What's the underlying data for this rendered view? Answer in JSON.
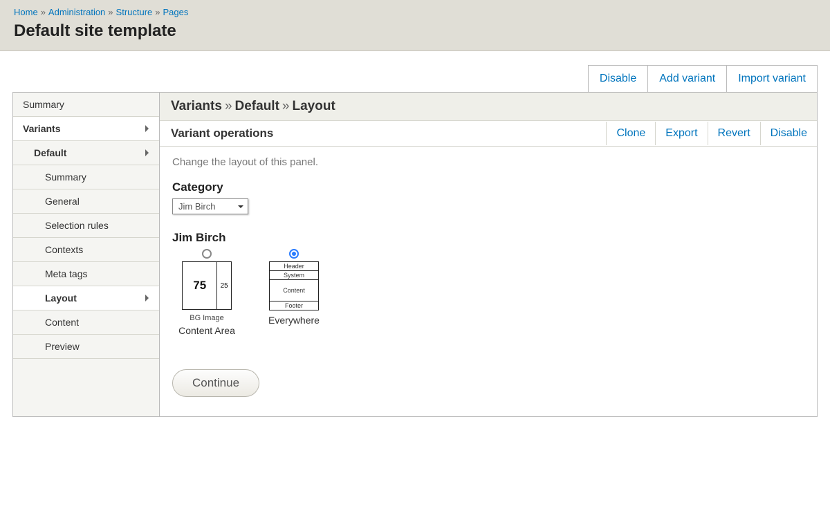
{
  "breadcrumb": [
    "Home",
    "Administration",
    "Structure",
    "Pages"
  ],
  "page_title": "Default site template",
  "top_actions": [
    "Disable",
    "Add variant",
    "Import variant"
  ],
  "sidebar": [
    {
      "label": "Summary",
      "bold": false,
      "active": false,
      "indent": 0,
      "caret": false
    },
    {
      "label": "Variants",
      "bold": true,
      "active": true,
      "indent": 0,
      "caret": true
    },
    {
      "label": "Default",
      "bold": true,
      "active": false,
      "indent": 1,
      "caret": true
    },
    {
      "label": "Summary",
      "bold": false,
      "active": false,
      "indent": 2,
      "caret": false
    },
    {
      "label": "General",
      "bold": false,
      "active": false,
      "indent": 2,
      "caret": false
    },
    {
      "label": "Selection rules",
      "bold": false,
      "active": false,
      "indent": 2,
      "caret": false
    },
    {
      "label": "Contexts",
      "bold": false,
      "active": false,
      "indent": 2,
      "caret": false
    },
    {
      "label": "Meta tags",
      "bold": false,
      "active": false,
      "indent": 2,
      "caret": false
    },
    {
      "label": "Layout",
      "bold": true,
      "active": true,
      "indent": 2,
      "caret": true
    },
    {
      "label": "Content",
      "bold": false,
      "active": false,
      "indent": 2,
      "caret": false
    },
    {
      "label": "Preview",
      "bold": false,
      "active": false,
      "indent": 2,
      "caret": false
    }
  ],
  "content_path": [
    "Variants",
    "Default",
    "Layout"
  ],
  "subbar_label": "Variant operations",
  "subbar_ops": [
    "Clone",
    "Export",
    "Revert",
    "Disable"
  ],
  "desc": "Change the layout of this panel.",
  "category": {
    "label": "Category",
    "selected": "Jim Birch"
  },
  "layout_group": {
    "label": "Jim Birch",
    "options": [
      {
        "name": "bg-image",
        "caption_small": "BG Image",
        "caption": "Content Area",
        "checked": false,
        "thumb": {
          "type": "cols",
          "col75": "75",
          "col25": "25"
        }
      },
      {
        "name": "everywhere",
        "caption_small": "",
        "caption": "Everywhere",
        "checked": true,
        "thumb": {
          "type": "rows",
          "rows": [
            "Header",
            "System",
            "Content",
            "Footer"
          ],
          "tall_index": 2
        }
      }
    ]
  },
  "continue_label": "Continue"
}
